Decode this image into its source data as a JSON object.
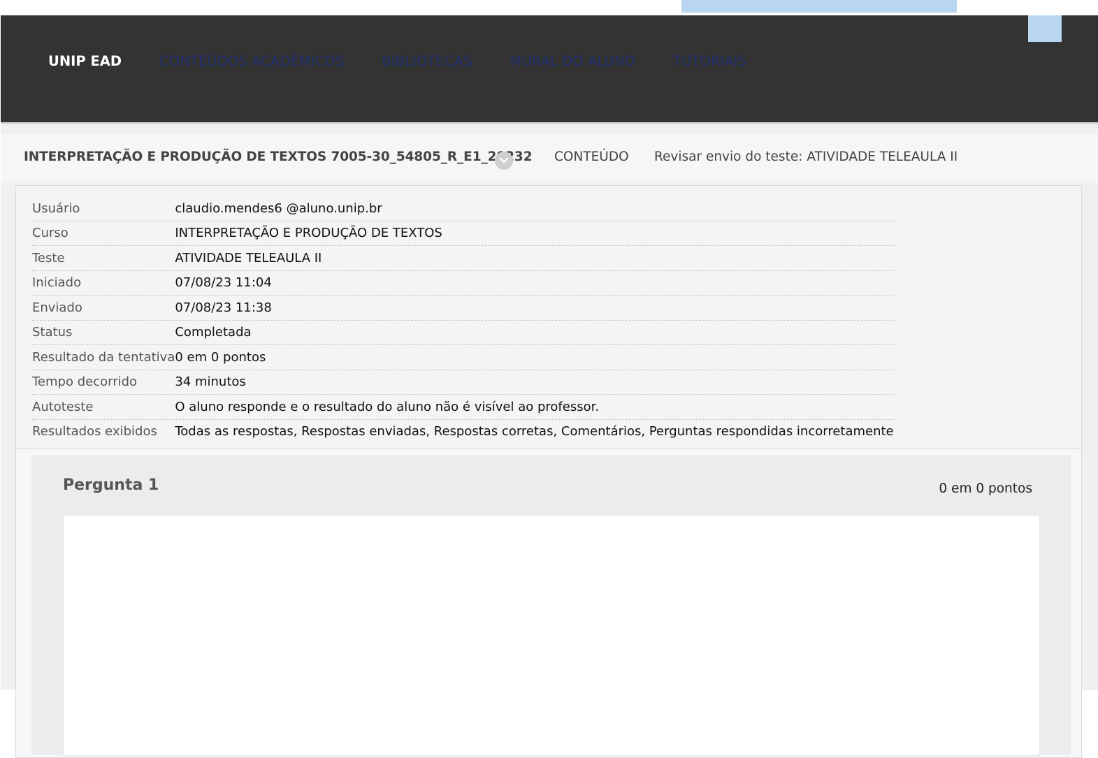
{
  "navbar": {
    "brand": "UNIP EAD",
    "links": [
      "CONTEÚDOS ACADÊMICOS",
      "BIBLIOTECAS",
      "MURAL DO ALUNO",
      "TUTORIAIS"
    ]
  },
  "breadcrumb": {
    "course": "INTERPRETAÇÃO E PRODUÇÃO DE TEXTOS 7005-30_54805_R_E1_20232",
    "content": "CONTEÚDO",
    "page": "Revisar envio do teste: ATIVIDADE TELEAULA II"
  },
  "details": [
    {
      "label": "Usuário",
      "value": "claudio.mendes6 @aluno.unip.br"
    },
    {
      "label": "Curso",
      "value": "INTERPRETAÇÃO E PRODUÇÃO DE TEXTOS"
    },
    {
      "label": "Teste",
      "value": "ATIVIDADE TELEAULA II"
    },
    {
      "label": "Iniciado",
      "value": "07/08/23 11:04"
    },
    {
      "label": "Enviado",
      "value": "07/08/23 11:38"
    },
    {
      "label": "Status",
      "value": "Completada"
    },
    {
      "label": "Resultado da tentativa",
      "value": "0 em 0 pontos"
    },
    {
      "label": "Tempo decorrido",
      "value": "34 minutos"
    },
    {
      "label": "Autoteste",
      "value": "O aluno responde e o resultado do aluno não é visível ao professor."
    },
    {
      "label": "Resultados exibidos",
      "value": "Todas as respostas, Respostas enviadas, Respostas corretas, Comentários, Perguntas respondidas incorretamente"
    }
  ],
  "question": {
    "title": "Pergunta 1",
    "points": "0 em 0 pontos"
  },
  "colors": {
    "navbar": "#333333",
    "nav_link": "#21306b",
    "accent": "#b8d6ef"
  }
}
